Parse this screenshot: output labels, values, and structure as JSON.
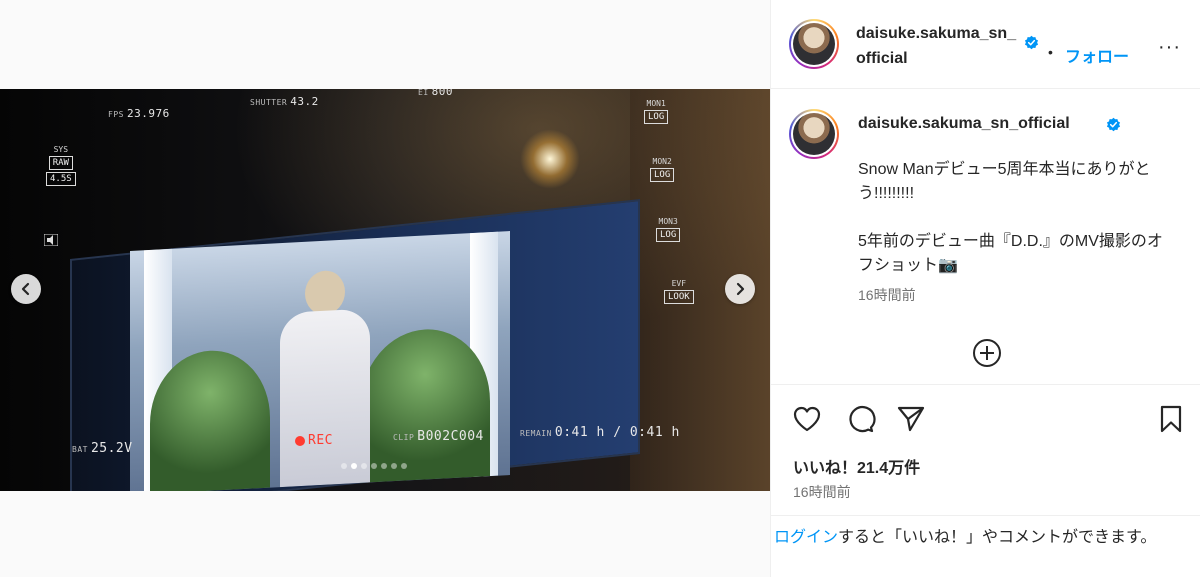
{
  "media": {
    "hud": {
      "fps_label": "FPS",
      "fps_value": "23.976",
      "shutter_label": "SHUTTER",
      "shutter_value": "43.2",
      "ei_label": "EI",
      "ei_value": "800",
      "sys_label": "SYS",
      "sys_raw": "RAW",
      "sys_res": "4.5S",
      "mon1_label": "MON1",
      "mon1_value": "LOG",
      "mon2_label": "MON2",
      "mon2_value": "LOG",
      "mon3_label": "MON3",
      "mon3_value": "LOG",
      "evf_label": "EVF",
      "evf_value": "LOOK",
      "bat_label": "BAT",
      "bat_value": "25.2V",
      "rec": "REC",
      "clip_label": "CLIP",
      "clip_value": "B002C004",
      "remain_label": "REMAIN",
      "remain_value": "0:41 h",
      "remain_total": "0:41 h"
    },
    "carousel": {
      "total": 7,
      "active_index": 1
    },
    "icons": {
      "prev": "chevron-left-icon",
      "next": "chevron-right-icon"
    }
  },
  "header": {
    "username": "daisuke.sakuma_sn_official",
    "separator": "•",
    "follow_label": "フォロー",
    "more_label": "···"
  },
  "caption": {
    "username": "daisuke.sakuma_sn_official",
    "text": "Snow Manデビュー5周年本当にありがとう!!!!!!!!!\n\n5年前のデビュー曲『D.D.』のMV撮影のオフショット📷",
    "time": "16時間前"
  },
  "actions": {
    "icons": [
      "heart-icon",
      "comment-icon",
      "share-icon",
      "bookmark-icon"
    ]
  },
  "likes_text": "いいね！21.4万件",
  "post_time": "16時間前",
  "login": {
    "link_label": "ログイン",
    "rest_text": "すると「いいね！」やコメントができます。"
  },
  "colors": {
    "accent": "#0095f6",
    "text": "#262626",
    "muted": "#737373",
    "border": "#efefef",
    "verified": "#0095f6"
  }
}
